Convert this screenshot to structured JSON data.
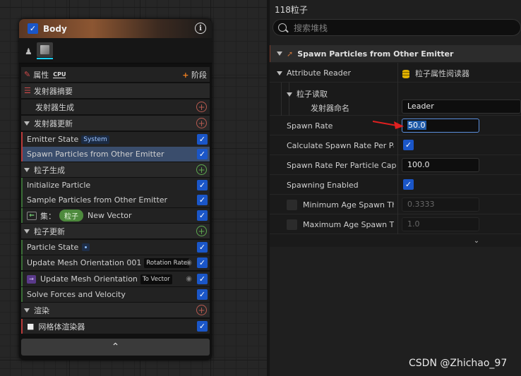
{
  "node": {
    "title": "Body",
    "props_label": "属性",
    "cpu_label": "CPU",
    "stage_label": "阶段",
    "emitter_summary": "发射器摘要",
    "emitter_spawn": "发射器生成",
    "emitter_update": "发射器更新",
    "emitter_state": "Emitter State",
    "emitter_state_tag": "System",
    "spawn_from_other": "Spawn Particles from Other Emitter",
    "particle_spawn": "粒子生成",
    "initialize_particle": "Initialize Particle",
    "sample_particles": "Sample Particles from Other Emitter",
    "set_label": "集：",
    "set_pill": "粒子",
    "set_value": "New Vector",
    "particle_update": "粒子更新",
    "particle_state": "Particle State",
    "update_mesh_001": "Update Mesh Orientation 001",
    "update_mesh_001_tag": "Rotation Rate",
    "update_mesh": "Update Mesh Orientation",
    "update_mesh_tag": "To Vector",
    "solve_forces": "Solve Forces and Velocity",
    "render": "渲染",
    "mesh_renderer": "网格体渲染器",
    "footer_chevron": "⌃"
  },
  "details": {
    "title": "118粒子",
    "search_placeholder": "搜索堆栈",
    "category": "Spawn Particles from Other Emitter",
    "attribute_reader": "Attribute Reader",
    "attribute_reader_value": "粒子属性阅读器",
    "particle_read": "粒子读取",
    "emitter_name": "发射器命名",
    "emitter_name_value": "Leader",
    "spawn_rate": "Spawn Rate",
    "spawn_rate_value": "50.0",
    "calc_spawn_rate": "Calculate Spawn Rate Per Particle",
    "spawn_rate_cap": "Spawn Rate Per Particle Cap",
    "spawn_rate_cap_value": "100.0",
    "spawning_enabled": "Spawning Enabled",
    "min_age": "Minimum Age Spawn Threshold",
    "min_age_value": "0.3333",
    "max_age": "Maximum Age Spawn Threshold",
    "max_age_value": "1.0",
    "expand_chevron": "⌄"
  },
  "watermark": "CSDN @Zhichao_97",
  "colors": {
    "accent_blue": "#1a56c8",
    "selection": "#3a4d6c",
    "add_green": "#5eaa4f",
    "add_red": "#b75a50",
    "arrow_red": "#e02020"
  }
}
